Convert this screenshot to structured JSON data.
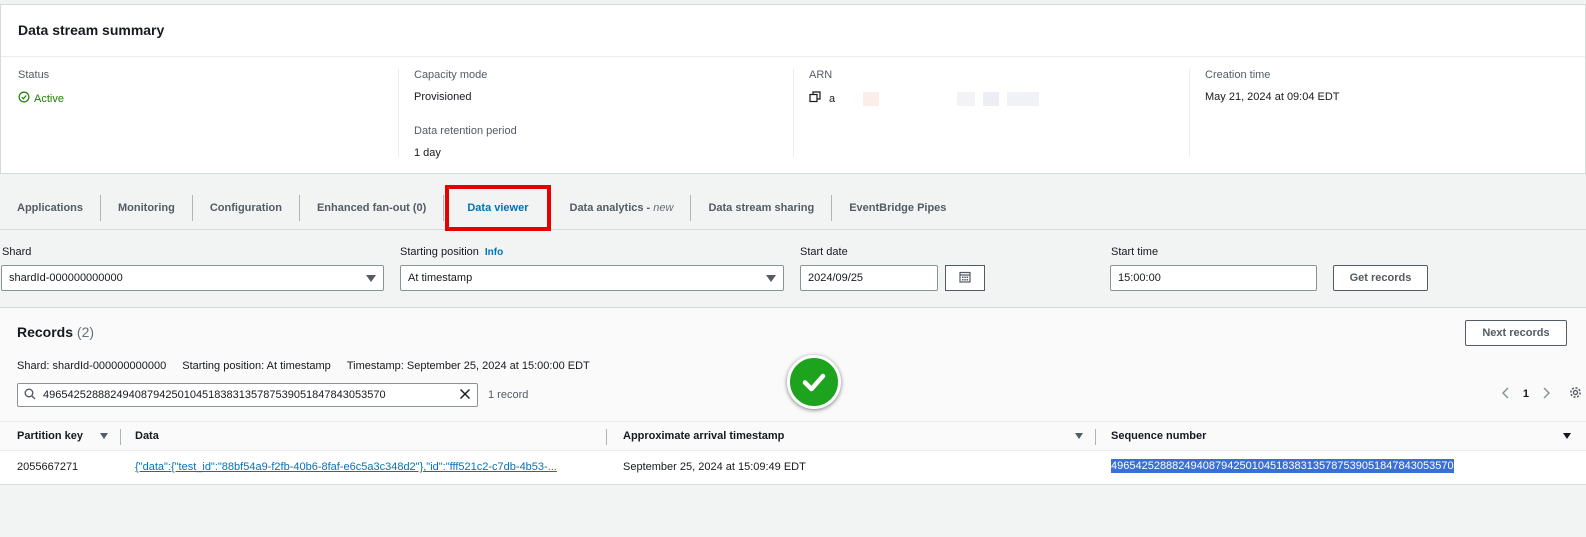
{
  "summary": {
    "title": "Data stream summary",
    "status_label": "Status",
    "status_value": "Active",
    "capacity_label": "Capacity mode",
    "capacity_value": "Provisioned",
    "retention_label": "Data retention period",
    "retention_value": "1 day",
    "arn_label": "ARN",
    "arn_value": "a",
    "creation_label": "Creation time",
    "creation_value": "May 21, 2024 at 09:04 EDT"
  },
  "tabs": [
    {
      "label": "Applications"
    },
    {
      "label": "Monitoring"
    },
    {
      "label": "Configuration"
    },
    {
      "label": "Enhanced fan-out (0)"
    },
    {
      "label": "Data viewer",
      "active": true
    },
    {
      "label": "Data analytics - ",
      "suffix": "new"
    },
    {
      "label": "Data stream sharing"
    },
    {
      "label": "EventBridge Pipes"
    }
  ],
  "form": {
    "shard_label": "Shard",
    "shard_value": "shardId-000000000000",
    "start_pos_label": "Starting position",
    "info_label": "Info",
    "start_pos_value": "At timestamp",
    "start_date_label": "Start date",
    "start_date_value": "2024/09/25",
    "start_time_label": "Start time",
    "start_time_value": "15:00:00",
    "get_records_label": "Get records"
  },
  "records": {
    "title": "Records",
    "count": "(2)",
    "next_label": "Next records",
    "meta_shard": "Shard: shardId-000000000000",
    "meta_position": "Starting position: At timestamp",
    "meta_timestamp": "Timestamp: September 25, 2024 at 15:00:00 EDT",
    "search_value": "49654252888249408794250104518383135787539051847843053570",
    "record_count": "1 record",
    "page": "1",
    "columns": {
      "partition_key": "Partition key",
      "data": "Data",
      "arrival": "Approximate arrival timestamp",
      "sequence": "Sequence number"
    },
    "rows": [
      {
        "partition_key": "2055667271",
        "data": "{\"data\":{\"test_id\":\"88bf54a9-f2fb-40b6-8faf-e6c5a3c348d2\"},\"id\":\"fff521c2-c7db-4b53-...",
        "arrival": "September 25, 2024 at 15:09:49 EDT",
        "sequence": "49654252888249408794250104518383135787539051847843053570"
      }
    ]
  },
  "colors": {
    "accent": "#0073bb",
    "status_green": "#1d8102",
    "highlight_red": "#e60000",
    "badge_green": "#1ea31e",
    "selection_blue": "#3a6fd6"
  }
}
